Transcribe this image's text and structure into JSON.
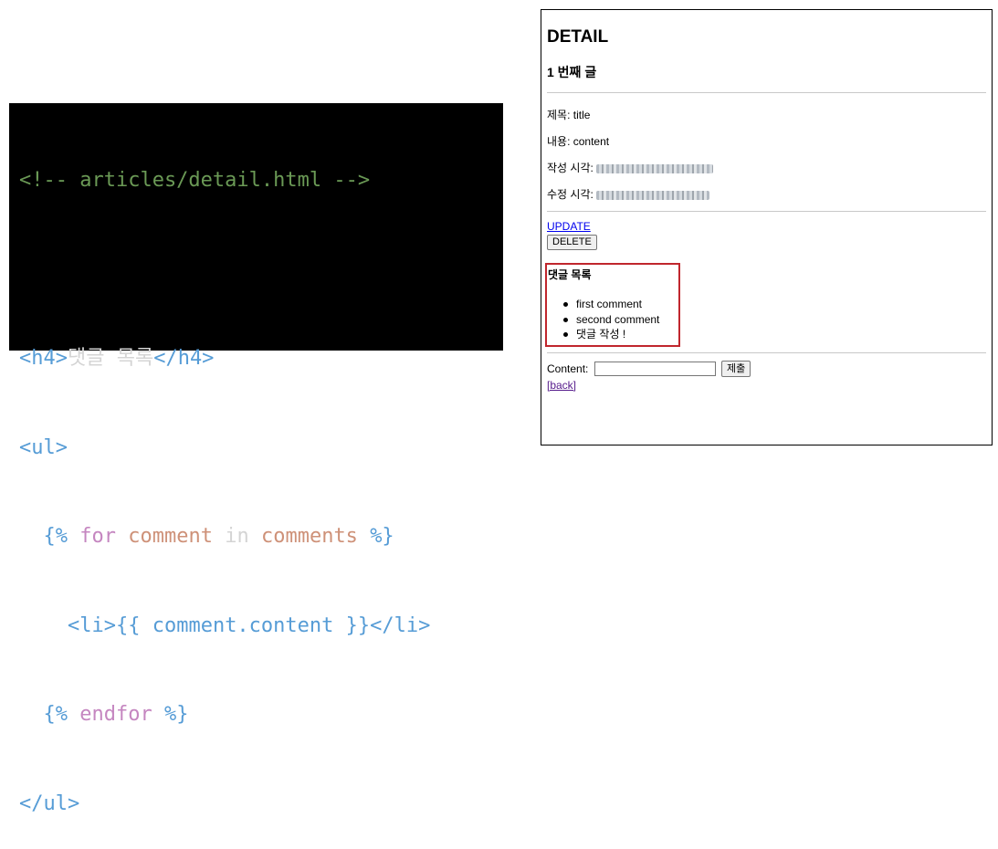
{
  "code": {
    "line1": "<!-- articles/detail.html -->",
    "h4_open": "<h4>",
    "h4_text": "댓글 목록",
    "h4_close": "</h4>",
    "ul_open": "<ul>",
    "for_open": "{%",
    "for_kw": "for",
    "for_var": "comment",
    "for_in": "in",
    "for_iter": "comments",
    "for_close": "%}",
    "li_open": "<li>",
    "var_open": "{{",
    "var_expr": "comment.content",
    "var_close": "}}",
    "li_close": "</li>",
    "endfor_open": "{%",
    "endfor_kw": "endfor",
    "endfor_close": "%}",
    "ul_close": "</ul>"
  },
  "page": {
    "title": "DETAIL",
    "subtitle": "1 번째 글",
    "title_label": "제목: title",
    "content_label": "내용: content",
    "created_label": "작성 시각:",
    "updated_label": "수정 시각:",
    "update_link": "UPDATE",
    "delete_button": "DELETE",
    "comments_heading": "댓글 목록",
    "comments": [
      "first comment",
      "second comment",
      "댓글 작성 !"
    ],
    "form_label": "Content:",
    "submit_button": "제출",
    "back_link": "[back]"
  },
  "colors": {
    "code_bg": "#000000",
    "comment": "#6a9955",
    "tag": "#569cd6",
    "keyword": "#c586c0",
    "variable": "#ce9178",
    "highlight_border": "#c0262d",
    "link": "#0000ee",
    "visited_link": "#551a8b"
  }
}
